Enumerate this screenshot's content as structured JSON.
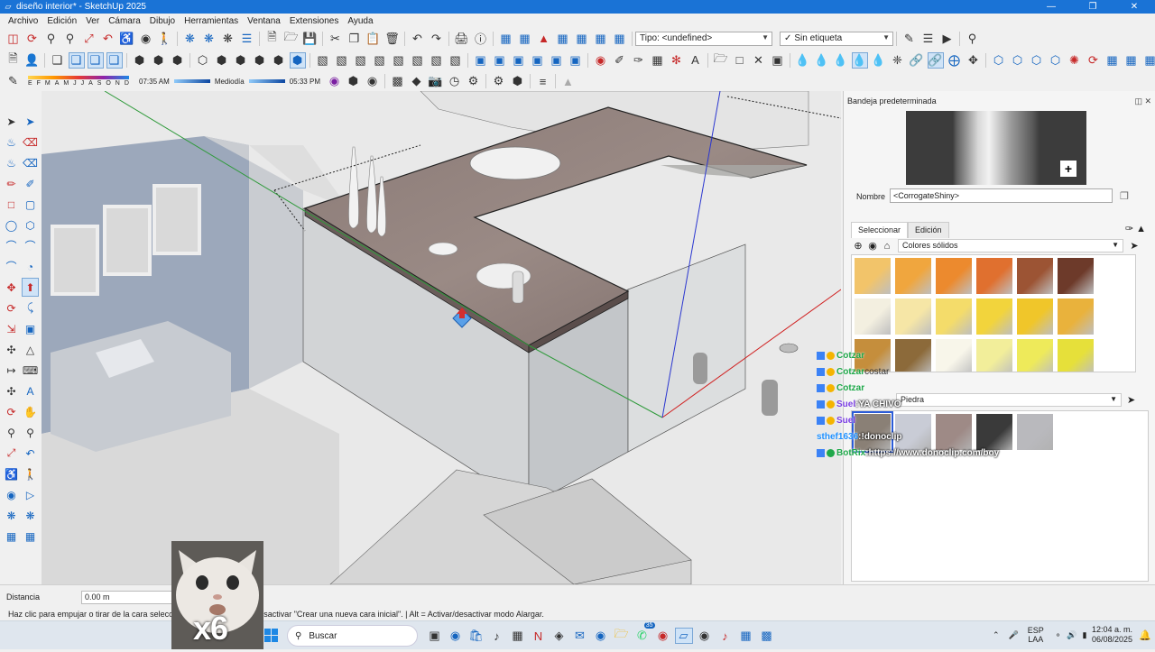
{
  "window": {
    "title": "diseño interior* - SketchUp 2025"
  },
  "menu": [
    "Archivo",
    "Edición",
    "Ver",
    "Cámara",
    "Dibujo",
    "Herramientas",
    "Ventana",
    "Extensiones",
    "Ayuda"
  ],
  "toolbar": {
    "tag_combo": "Tipo: <undefined>",
    "label_combo": "Sin etiqueta"
  },
  "shadows": {
    "months": [
      "E",
      "F",
      "M",
      "A",
      "M",
      "J",
      "J",
      "A",
      "S",
      "O",
      "N",
      "D"
    ],
    "time_start": "07:35 AM",
    "time_mid": "Mediodía",
    "time_end": "05:33 PM"
  },
  "panel": {
    "title": "Bandeja predeterminada",
    "name_label": "Nombre",
    "name_value": "<CorrogateShiny>",
    "tab_select": "Seleccionar",
    "tab_edit": "Edición",
    "library1": "Colores sólidos",
    "library2": "Piedra"
  },
  "chat": [
    {
      "user": "Cotzar",
      "msg": ""
    },
    {
      "user": "Cotzar",
      "msg": "costar"
    },
    {
      "user": "Cotzar",
      "msg": ""
    },
    {
      "user": "Suel",
      "msg": "YA CHIVO"
    },
    {
      "user": "Suel",
      "msg": ""
    },
    {
      "user": "sthef1636",
      "msg": "!donoclip"
    },
    {
      "user": "BotRix",
      "msg": "https://www.donoclip.com/boy"
    }
  ],
  "status": {
    "distance_label": "Distancia",
    "distance_value": "0.00 m",
    "hint": "Haz clic para empujar o tirar de la cara seleccionada. | Ctrl = Activar/desactivar \"Crear una nueva cara inicial\". | Alt = Activar/desactivar modo Alargar."
  },
  "overlay": {
    "multiplier": "x6"
  },
  "taskbar": {
    "search_placeholder": "Buscar",
    "lang1": "ESP",
    "lang2": "LAA",
    "time": "12:04 a. m.",
    "date": "06/08/2025",
    "badge": "35"
  },
  "colors": {
    "accent": "#1a73d6",
    "selection_blue": "#2a5bd7"
  }
}
